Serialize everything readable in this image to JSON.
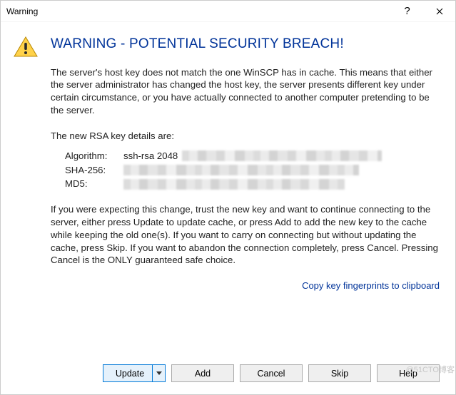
{
  "window": {
    "title": "Warning"
  },
  "heading": "WARNING - POTENTIAL SECURITY BREACH!",
  "para1": "The server's host key does not match the one WinSCP has in cache. This means that either the server administrator has changed the host key, the server presents different key under certain circumstance, or you have actually connected to another computer pretending to be the server.",
  "para2": "The new RSA key details are:",
  "key": {
    "algo_label": "Algorithm:",
    "algo_value": "ssh-rsa 2048",
    "sha_label": "SHA-256:",
    "md5_label": "MD5:"
  },
  "para3": "If you were expecting this change, trust the new key and want to continue connecting to the server, either press Update to update cache, or press Add to add the new key to the cache while keeping the old one(s). If you want to carry on connecting but without updating the cache, press Skip. If you want to abandon the connection completely, press Cancel. Pressing Cancel is the ONLY guaranteed safe choice.",
  "link": "Copy key fingerprints to clipboard",
  "buttons": {
    "update": "Update",
    "add": "Add",
    "cancel": "Cancel",
    "skip": "Skip",
    "help": "Help"
  },
  "watermark": "@51CTO博客"
}
